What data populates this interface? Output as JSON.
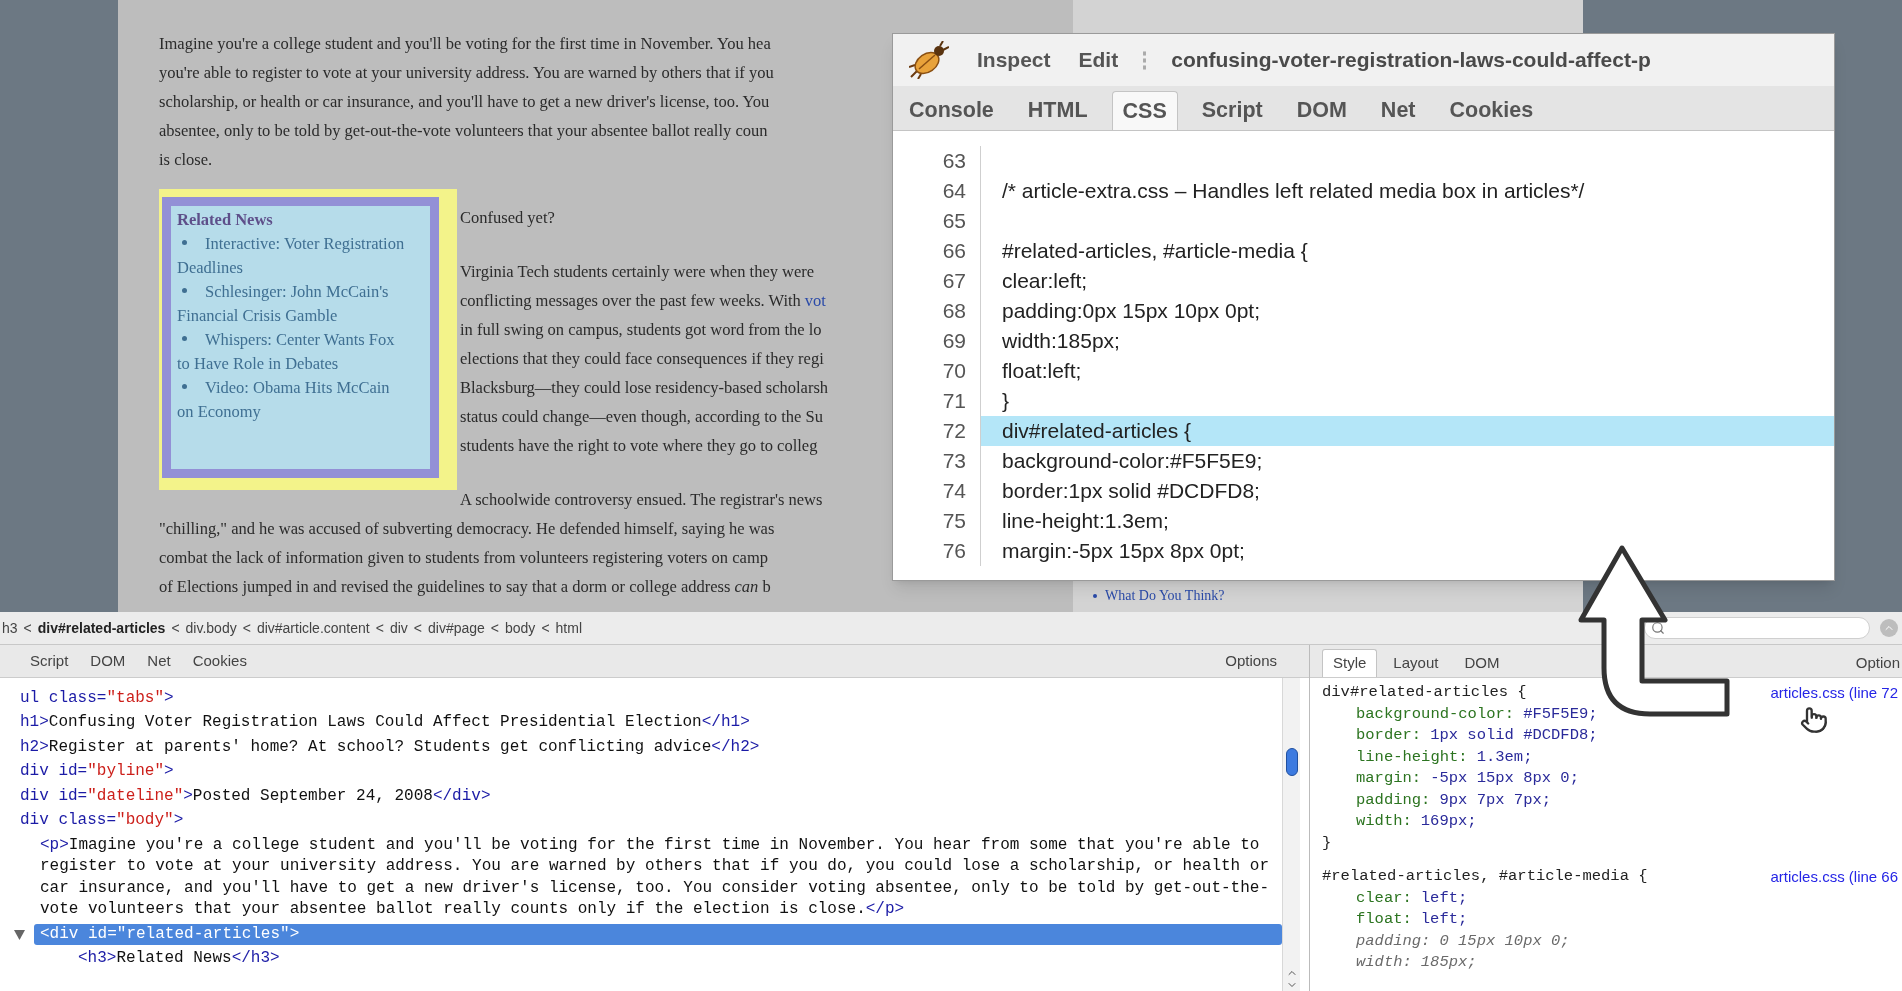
{
  "article": {
    "intro_lines": [
      "Imagine you're a college student and you'll be voting for the first time in November. You hea",
      "you're able to register to vote at your university address. You are warned by others that if you",
      "scholarship, or health or car insurance, and you'll have to get a new driver's license, too. You",
      "absentee, only to be told by get-out-the-vote volunteers that your absentee ballot really coun",
      "is close."
    ],
    "related_news": {
      "title": "Related News",
      "items": [
        "Interactive: Voter Registration Deadlines",
        "Schlesinger: John McCain's Financial Crisis Gamble",
        "Whispers: Center Wants Fox to Have Role in Debates",
        "Video: Obama Hits McCain on Economy"
      ]
    },
    "side_paragraphs": [
      [
        {
          "text": "Confused yet?"
        }
      ],
      [
        {
          "text": "Virginia Tech students certainly were when they were"
        },
        {
          "text": "conflicting messages over the past few weeks. With",
          "link": "vot"
        },
        {
          "text": "in full swing on campus, students got word from the lo"
        },
        {
          "text": "elections that they could face consequences if they regi"
        },
        {
          "text": "Blacksburg—they could lose residency-based scholarsh"
        },
        {
          "text": "status could change—even though, according to the Su"
        },
        {
          "text": "students have the right to vote where they go to colleg"
        }
      ],
      [
        {
          "text": "A schoolwide controversy ensued. The registrar's news"
        }
      ]
    ],
    "after_lines": [
      "\"chilling,\" and he was accused of subverting democracy. He defended himself, saying he was",
      "combat the lack of information given to students from volunteers registering voters on camp",
      "of Elections jumped in and revised the guidelines to say that a dorm or college address *can* b"
    ],
    "sidebar_link": "What Do You Think?"
  },
  "inspector": {
    "menu": [
      "Inspect",
      "Edit"
    ],
    "menu_separator": "⋮",
    "title": "confusing-voter-registration-laws-could-affect-p",
    "tabs": [
      {
        "label": "Console",
        "selected": false
      },
      {
        "label": "HTML",
        "selected": false
      },
      {
        "label": "CSS",
        "selected": true
      },
      {
        "label": "Script",
        "selected": false
      },
      {
        "label": "DOM",
        "selected": false
      },
      {
        "label": "Net",
        "selected": false
      },
      {
        "label": "Cookies",
        "selected": false
      }
    ],
    "code_lines": [
      {
        "number": "63",
        "highlighted": false
      },
      {
        "number": "64",
        "code": "/* article-extra.css – Handles left related media box in articles*/",
        "highlighted": false
      },
      {
        "number": "65",
        "highlighted": false
      },
      {
        "number": "66",
        "code": "#related-articles, #article-media {",
        "highlighted": false
      },
      {
        "number": "67",
        "code": "clear:left;",
        "highlighted": false
      },
      {
        "number": "68",
        "code": "padding:0px 15px 10px 0pt;",
        "highlighted": false
      },
      {
        "number": "69",
        "code": "width:185px;",
        "highlighted": false
      },
      {
        "number": "70",
        "code": "float:left;",
        "highlighted": false
      },
      {
        "number": "71",
        "code": "}",
        "highlighted": false
      },
      {
        "number": "72",
        "code": "div#related-articles {",
        "highlighted": true
      },
      {
        "number": "73",
        "code": "background-color:#F5F5E9;",
        "highlighted": false
      },
      {
        "number": "74",
        "code": "border:1px solid #DCDFD8;",
        "highlighted": false
      },
      {
        "number": "75",
        "code": "line-height:1.3em;",
        "highlighted": false
      },
      {
        "number": "76",
        "code": "margin:-5px 15px 8px 0pt;",
        "highlighted": false
      }
    ]
  },
  "firebug": {
    "breadcrumb": [
      {
        "label": "h3",
        "selected": false
      },
      {
        "label": "div#related-articles",
        "selected": true
      },
      {
        "label": "div.body",
        "selected": false
      },
      {
        "label": "div#article.content",
        "selected": false
      },
      {
        "label": "div",
        "selected": false
      },
      {
        "label": "div#page",
        "selected": false
      },
      {
        "label": "body",
        "selected": false
      },
      {
        "label": "html",
        "selected": false
      }
    ],
    "separator": "<",
    "tabs": [
      {
        "label": "Script",
        "selected": false
      },
      {
        "label": "DOM",
        "selected": false
      },
      {
        "label": "Net",
        "selected": false
      },
      {
        "label": "Cookies",
        "selected": false
      }
    ],
    "options": "Options",
    "tree": [
      {
        "segments": [
          {
            "kind": "tag",
            "text": "ul"
          },
          {
            "kind": "attr",
            "text": " class="
          },
          {
            "kind": "value",
            "text": "\"tabs\""
          },
          {
            "kind": "tag",
            "text": ">"
          }
        ]
      },
      {
        "segments": [
          {
            "kind": "tag",
            "text": "h1>"
          },
          {
            "kind": "text",
            "text": "Confusing Voter Registration Laws Could Affect Presidential Election"
          },
          {
            "kind": "tag",
            "text": "</h1>"
          }
        ]
      },
      {
        "segments": [
          {
            "kind": "tag",
            "text": "h2>"
          },
          {
            "kind": "text",
            "text": "Register at parents' home? At school? Students get conflicting advice"
          },
          {
            "kind": "tag",
            "text": "</h2>"
          }
        ]
      },
      {
        "segments": [
          {
            "kind": "tag",
            "text": "div"
          },
          {
            "kind": "attr",
            "text": " id="
          },
          {
            "kind": "value",
            "text": "\"byline\""
          },
          {
            "kind": "tag",
            "text": ">"
          }
        ]
      },
      {
        "segments": [
          {
            "kind": "tag",
            "text": "div"
          },
          {
            "kind": "attr",
            "text": " id="
          },
          {
            "kind": "value",
            "text": "\"dateline\""
          },
          {
            "kind": "tag",
            "text": ">"
          },
          {
            "kind": "text",
            "text": "Posted September 24, 2008"
          },
          {
            "kind": "tag",
            "text": "</div>"
          }
        ]
      },
      {
        "segments": [
          {
            "kind": "tag",
            "text": "div"
          },
          {
            "kind": "attr",
            "text": " class="
          },
          {
            "kind": "value",
            "text": "\"body\""
          },
          {
            "kind": "tag",
            "text": ">"
          }
        ],
        "children": [
          {
            "segments": [
              {
                "kind": "tag",
                "text": "<p>"
              },
              {
                "kind": "text",
                "text": "Imagine you're a college student and you'll be voting for the first time in November. You hear from some that you're able to register to vote at your university address. You are warned by others that if you do, you could lose a scholarship, or health or car insurance, and you'll have to get a new driver's license, too. You consider voting absentee, only to be told by get-out-the-vote volunteers that your absentee ballot really counts only if the election is close."
              },
              {
                "kind": "tag",
                "text": "</p>"
              }
            ],
            "selected": false
          },
          {
            "segments": [
              {
                "kind": "tag",
                "text": "<div"
              },
              {
                "kind": "attr",
                "text": " id="
              },
              {
                "kind": "value",
                "text": "\"related-articles\""
              },
              {
                "kind": "tag",
                "text": ">"
              }
            ],
            "selected": true,
            "expanded": true,
            "children": [
              {
                "segments": [
                  {
                    "kind": "tag",
                    "text": "<h3>"
                  },
                  {
                    "kind": "text",
                    "text": "Related News"
                  },
                  {
                    "kind": "tag",
                    "text": "</h3>"
                  }
                ],
                "selected": false
              }
            ]
          }
        ]
      }
    ],
    "style_tabs": [
      {
        "label": "Style",
        "selected": true
      },
      {
        "label": "Layout",
        "selected": false
      },
      {
        "label": "DOM",
        "selected": false
      }
    ],
    "style_options": "Option",
    "rules": [
      {
        "selector": "div#related-articles {",
        "source": "articles.css (line 72",
        "close": "}",
        "declarations": [
          {
            "name": "background-color:",
            "value": "#F5F5E9;",
            "overridden": false
          },
          {
            "name": "border:",
            "value": "1px solid #DCDFD8;",
            "overridden": false
          },
          {
            "name": "line-height:",
            "value": "1.3em;",
            "overridden": false
          },
          {
            "name": "margin:",
            "value": "-5px 15px 8px 0;",
            "overridden": false
          },
          {
            "name": "padding:",
            "value": "9px 7px 7px;",
            "overridden": false
          },
          {
            "name": "width:",
            "value": "169px;",
            "overridden": false
          }
        ]
      },
      {
        "selector": "#related-articles, #article-media {",
        "source": "articles.css (line 66",
        "declarations": [
          {
            "name": "clear:",
            "value": "left;",
            "overridden": false
          },
          {
            "name": "float:",
            "value": "left;",
            "overridden": false
          },
          {
            "name": "padding:",
            "value": "0 15px 10px 0;",
            "overridden": true
          },
          {
            "name": "width:",
            "value": "185px;",
            "overridden": true
          }
        ]
      }
    ]
  }
}
